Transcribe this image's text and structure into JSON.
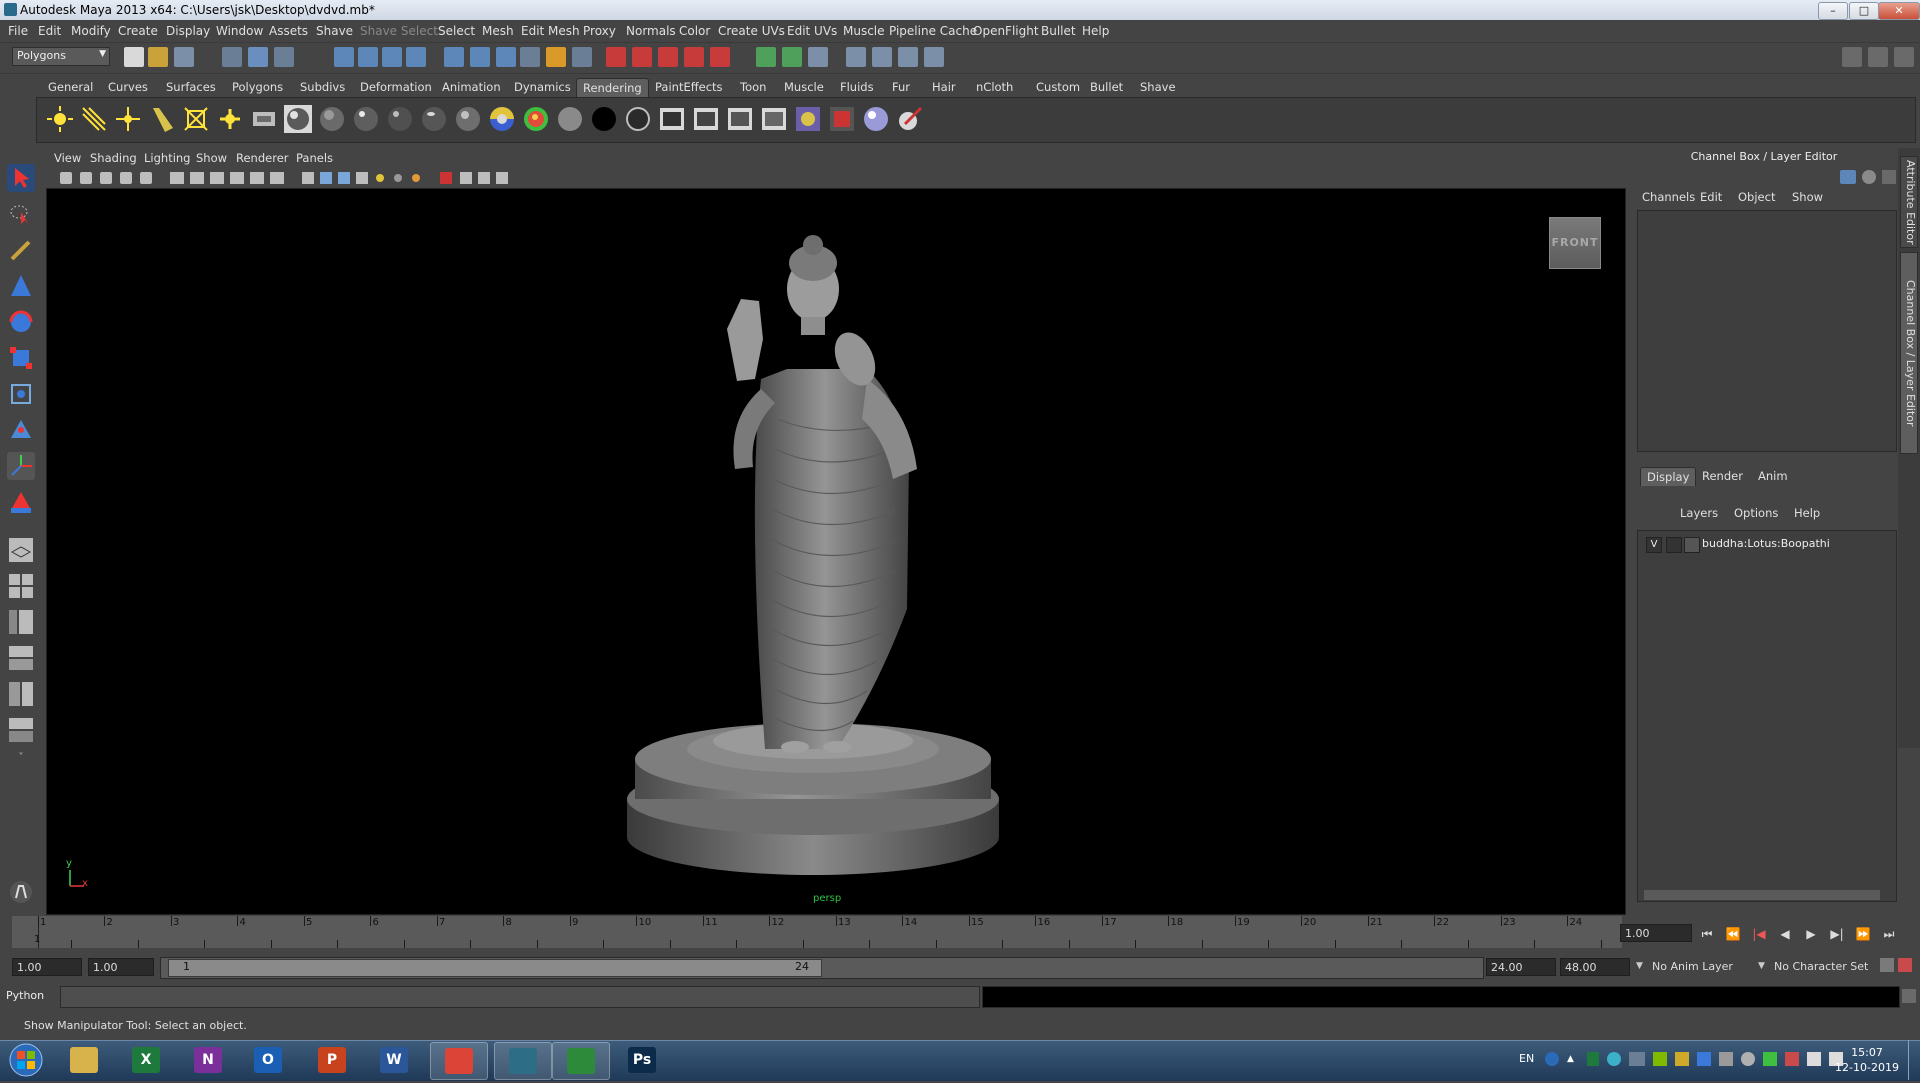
{
  "window": {
    "title": "Autodesk Maya 2013 x64: C:\\Users\\jsk\\Desktop\\dvdvd.mb*",
    "controls": [
      "–",
      "□",
      "✕"
    ]
  },
  "menubar": [
    "File",
    "Edit",
    "Modify",
    "Create",
    "Display",
    "Window",
    "Assets",
    "Shave",
    "Shave Select",
    "Select",
    "Mesh",
    "Edit Mesh",
    "Proxy",
    "Normals",
    "Color",
    "Create UVs",
    "Edit UVs",
    "Muscle",
    "Pipeline Cache",
    "OpenFlight",
    "Bullet",
    "Help"
  ],
  "statusline": {
    "mode": "Polygons"
  },
  "shelf": {
    "tabs": [
      "General",
      "Curves",
      "Surfaces",
      "Polygons",
      "Subdivs",
      "Deformation",
      "Animation",
      "Dynamics",
      "Rendering",
      "PaintEffects",
      "Toon",
      "Muscle",
      "Fluids",
      "Fur",
      "Hair",
      "nCloth",
      "Custom",
      "Bullet",
      "Shave"
    ],
    "active_tab": "Rendering"
  },
  "viewport": {
    "menus": [
      "View",
      "Shading",
      "Lighting",
      "Show",
      "Renderer",
      "Panels"
    ],
    "viewcube_label": "FRONT",
    "axis_y": "y",
    "axis_x": "x",
    "mesh_label": "persp"
  },
  "channel_box": {
    "header": "Channel Box / Layer Editor",
    "menus": [
      "Channels",
      "Edit",
      "Object",
      "Show"
    ]
  },
  "layer_editor": {
    "tabs": [
      "Display",
      "Render",
      "Anim"
    ],
    "active_tab": "Display",
    "menus": [
      "Layers",
      "Options",
      "Help"
    ],
    "layers": [
      {
        "visible": "V",
        "name": "buddha:Lotus:Boopathi"
      }
    ]
  },
  "side_tabs": [
    "Attribute Editor",
    "Channel Box / Layer Editor"
  ],
  "time_slider": {
    "ticks": [
      "1",
      "2",
      "3",
      "4",
      "5",
      "6",
      "7",
      "8",
      "9",
      "10",
      "11",
      "12",
      "13",
      "14",
      "15",
      "16",
      "17",
      "18",
      "19",
      "20",
      "21",
      "22",
      "23",
      "24"
    ],
    "current_frame_marker": "1",
    "current_time": "1.00"
  },
  "range_slider": {
    "start_time": "1.00",
    "playback_start": "1.00",
    "range_start_label": "1",
    "range_end_label": "24",
    "playback_end": "24.00",
    "end_time": "48.00",
    "anim_layer": "No Anim Layer",
    "character_set": "No Character Set"
  },
  "command_line": {
    "language": "Python"
  },
  "help_line": "Show Manipulator Tool: Select an object.",
  "taskbar": {
    "apps": [
      {
        "name": "explorer",
        "label": "",
        "color": "#d8b24a"
      },
      {
        "name": "excel",
        "label": "X",
        "color": "#1e7a3c"
      },
      {
        "name": "onenote",
        "label": "N",
        "color": "#7a2f9a"
      },
      {
        "name": "outlook",
        "label": "O",
        "color": "#1a5fb4"
      },
      {
        "name": "powerpoint",
        "label": "P",
        "color": "#c8431d"
      },
      {
        "name": "word",
        "label": "W",
        "color": "#2b579a"
      },
      {
        "name": "chrome",
        "label": "",
        "color": "#db4437"
      },
      {
        "name": "maya",
        "label": "",
        "color": "#2d6d86"
      },
      {
        "name": "camtasia",
        "label": "",
        "color": "#2d8a3a"
      },
      {
        "name": "photoshop",
        "label": "Ps",
        "color": "#0c2a4a"
      }
    ],
    "lang": "EN",
    "time": "15:07",
    "date": "12-10-2019"
  }
}
